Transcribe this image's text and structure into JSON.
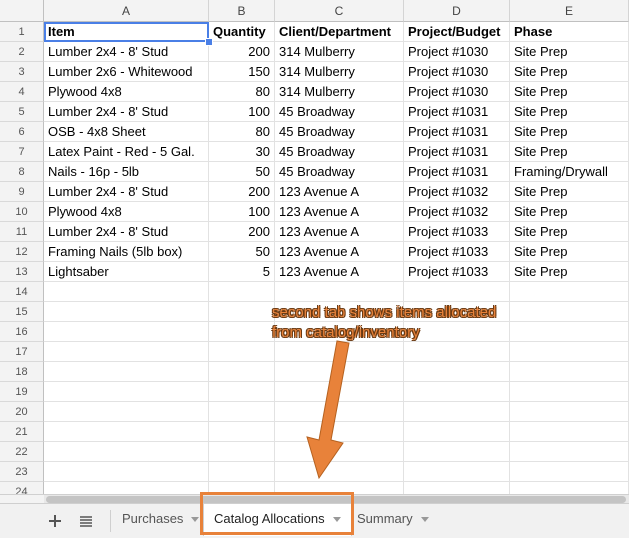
{
  "spreadsheet": {
    "columns": [
      "A",
      "B",
      "C",
      "D",
      "E"
    ],
    "header": [
      "Item",
      "Quantity",
      "Client/Department",
      "Project/Budget",
      "Phase"
    ],
    "rows": [
      [
        "Lumber 2x4 - 8' Stud",
        "200",
        "314 Mulberry",
        "Project #1030",
        "Site Prep"
      ],
      [
        "Lumber 2x6 - Whitewood",
        "150",
        "314 Mulberry",
        "Project #1030",
        "Site Prep"
      ],
      [
        "Plywood 4x8",
        "80",
        "314 Mulberry",
        "Project #1030",
        "Site Prep"
      ],
      [
        "Lumber 2x4 - 8' Stud",
        "100",
        "45 Broadway",
        "Project #1031",
        "Site Prep"
      ],
      [
        "OSB - 4x8 Sheet",
        "80",
        "45 Broadway",
        "Project #1031",
        "Site Prep"
      ],
      [
        "Latex Paint - Red - 5 Gal.",
        "30",
        "45 Broadway",
        "Project #1031",
        "Site Prep"
      ],
      [
        "Nails - 16p - 5lb",
        "50",
        "45 Broadway",
        "Project #1031",
        "Framing/Drywall"
      ],
      [
        "Lumber 2x4 - 8' Stud",
        "200",
        "123 Avenue A",
        "Project #1032",
        "Site Prep"
      ],
      [
        "Plywood 4x8",
        "100",
        "123 Avenue A",
        "Project #1032",
        "Site Prep"
      ],
      [
        "Lumber 2x4 - 8' Stud",
        "200",
        "123 Avenue A",
        "Project #1033",
        "Site Prep"
      ],
      [
        "Framing Nails (5lb box)",
        "50",
        "123 Avenue A",
        "Project #1033",
        "Site Prep"
      ],
      [
        "Lightsaber",
        "5",
        "123 Avenue A",
        "Project #1033",
        "Site Prep"
      ]
    ],
    "row_numbers": [
      "1",
      "2",
      "3",
      "4",
      "5",
      "6",
      "7",
      "8",
      "9",
      "10",
      "11",
      "12",
      "13",
      "14",
      "15",
      "16",
      "17",
      "18",
      "19",
      "20",
      "21",
      "22",
      "23",
      "24"
    ]
  },
  "tabs": {
    "add_icon": "plus-icon",
    "list_icon": "menu-icon",
    "items": [
      {
        "label": "Purchases",
        "active": false
      },
      {
        "label": "Catalog Allocations",
        "active": true
      },
      {
        "label": "Summary",
        "active": false
      }
    ]
  },
  "annotation": {
    "text_line1": "second tab shows items allocated",
    "text_line2": "from catalog/inventory",
    "color": "#e8823a"
  },
  "colors": {
    "selection": "#4a7fe6",
    "header_bg": "#f3f3f3"
  }
}
